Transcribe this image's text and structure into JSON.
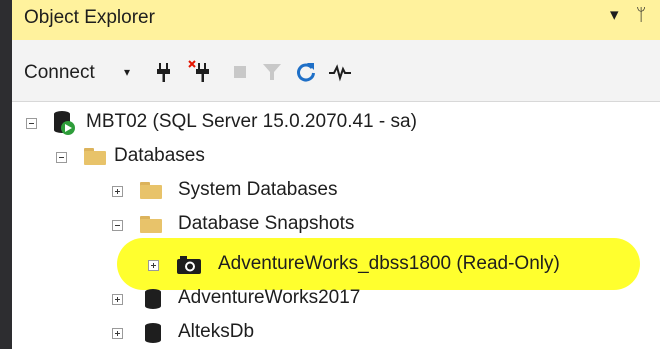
{
  "panel": {
    "title": "Object Explorer",
    "dropdown_glyph": "▾",
    "pin_glyph": "ᛘ"
  },
  "toolbar": {
    "connect_label": "Connect",
    "connect_caret": "▾",
    "icons": [
      "connect-plug-icon",
      "disconnect-plug-icon",
      "stop-icon",
      "filter-icon",
      "refresh-icon",
      "activity-monitor-icon"
    ]
  },
  "tree": {
    "server": "MBT02 (SQL Server 15.0.2070.41 - sa)",
    "databases": "Databases",
    "system_databases": "System Databases",
    "database_snapshots": "Database Snapshots",
    "snapshot_item": "AdventureWorks_dbss1800 (Read-Only)",
    "db1": "AdventureWorks2017",
    "db2": "AlteksDb"
  },
  "colors": {
    "title_bar": "#fff29d",
    "highlight": "#ffff2e",
    "folder": "#e8c36a",
    "gutter": "#2d2d30"
  }
}
